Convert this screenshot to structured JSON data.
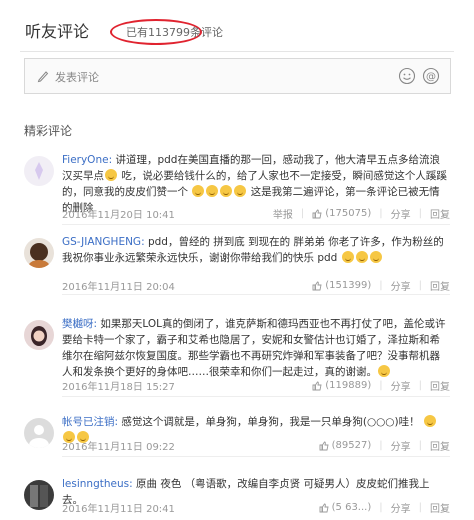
{
  "header": {
    "title": "听友评论",
    "count_text": "已有113799条评论"
  },
  "composer": {
    "placeholder": "发表评论"
  },
  "section": {
    "title": "精彩评论"
  },
  "comments": [
    {
      "user": "FieryOne:",
      "text": "讲道理，pdd在美国直播的那一回，感动我了，他大清早五点多给流浪汉买早点",
      "text2": "吃，说必要给钱什么的，给了人家也不一定接受，瞬间感觉这个人蹊蹊的，同意我的皮皮们赞一个",
      "text3": "这是我第二遍评论，第一条评论已被无情的删除",
      "time": "2016年11月20日 10:41",
      "report": "举报",
      "likes": "(175075)",
      "share": "分享",
      "reply": "回复"
    },
    {
      "user": "GS-JIANGHENG:",
      "text": "pdd，曾经的 拼到底 到现在的 胖弟弟 你老了许多，作为粉丝的我祝你事业永远繁荣永远快乐，谢谢你带给我们的快乐 pdd",
      "time": "2016年11月11日 20:04",
      "likes": "(151399)",
      "share": "分享",
      "reply": "回复"
    },
    {
      "user": "樊樾呀:",
      "text": "如果那天LOL真的倒闭了，谁克萨斯和德玛西亚也不再打仗了吧，盖伦或许要给卡特一个家了，霸子和艾希也隐居了，安妮和女警估计也订婚了，泽拉斯和希维尔在缩阿兹尔恢复国度。那些学霸也不再研究炸弹和军事装备了吧？没事帮机器人和发条换个更好的身体吧……很荣幸和你们一起走过，真的谢谢。",
      "time": "2016年11月18日 15:27",
      "likes": "(119889)",
      "share": "分享",
      "reply": "回复"
    },
    {
      "user": "帐号已注销:",
      "text": "感觉这个调就是，单身狗，单身狗，我是一只单身狗(○○○)哇！",
      "time": "2016年11月11日 09:22",
      "likes": "(89527)",
      "share": "分享",
      "reply": "回复"
    },
    {
      "user": "lesinngtheus:",
      "text": "原曲 夜色 （粤语歌，改编自李贞贤 可疑男人）皮皮蛇们推我上去。",
      "time": "2016年11月11日 20:41",
      "likes": "(5 63...)",
      "share": "分享",
      "reply": "回复"
    }
  ]
}
